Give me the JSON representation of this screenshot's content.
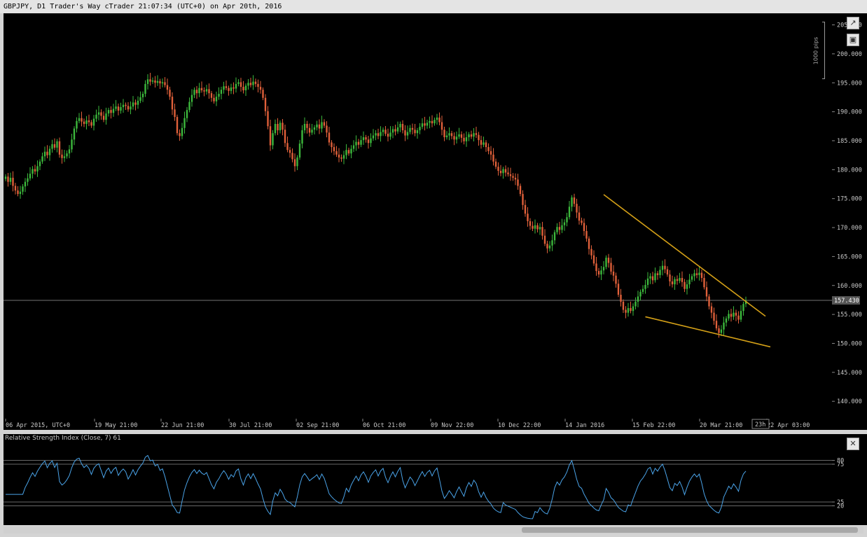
{
  "header": {
    "title": "GBPJPY, D1 Trader's Way cTrader 21:07:34 (UTC+0) on Apr 20th, 2016"
  },
  "toolbar": {
    "popout_icon": "popout-icon",
    "camera_icon": "camera-icon",
    "close_icon": "close-icon"
  },
  "pips_label": "1000 pips",
  "price_tag": "157.430",
  "time_tag": "23h",
  "rsi": {
    "label": "Relative Strength Index (Close, 7) 61",
    "value": 61,
    "level_labels": [
      "80",
      "75",
      "25",
      "20"
    ]
  },
  "colors": {
    "bull": "#3cb83c",
    "bear": "#e0603a",
    "trendline": "#d4a017",
    "rsi_line": "#4aa3e8",
    "background": "#000000"
  },
  "chart_data": [
    {
      "type": "candlestick",
      "symbol": "GBPJPY",
      "timeframe": "D1",
      "y_ticks": [
        "205.000",
        "200.000",
        "195.000",
        "190.000",
        "185.000",
        "180.000",
        "175.000",
        "170.000",
        "165.000",
        "160.000",
        "155.000",
        "150.000",
        "145.000",
        "140.000"
      ],
      "ylim": [
        137,
        207
      ],
      "x_ticks": [
        "06 Apr 2015, UTC+0",
        "19 May 21:00",
        "22 Jun 21:00",
        "30 Jul 21:00",
        "02 Sep 21:00",
        "06 Oct 21:00",
        "09 Nov 22:00",
        "10 Dec 22:00",
        "14 Jan 2016",
        "15 Feb 22:00",
        "20 Mar 21:00",
        "22 Apr 03:00"
      ],
      "current_price": 157.43,
      "closes": [
        178.8,
        177.9,
        178.6,
        177.2,
        176.4,
        175.8,
        176.2,
        177.1,
        177.9,
        178.5,
        179.3,
        180.1,
        179.7,
        180.6,
        181.4,
        182.3,
        183.1,
        182.5,
        183.6,
        184.4,
        183.8,
        184.9,
        182.6,
        182.0,
        182.3,
        182.8,
        183.5,
        185.2,
        187.1,
        188.4,
        188.9,
        188.3,
        187.9,
        188.5,
        188.2,
        187.6,
        188.8,
        189.5,
        189.9,
        189.3,
        188.6,
        189.7,
        190.3,
        189.8,
        190.5,
        190.9,
        190.2,
        190.8,
        191.2,
        191.0,
        190.4,
        190.9,
        191.6,
        191.2,
        191.9,
        192.5,
        193.1,
        194.8,
        195.6,
        195.2,
        195.4,
        195.0,
        195.3,
        194.9,
        195.1,
        194.6,
        193.8,
        192.6,
        190.4,
        189.1,
        186.3,
        185.8,
        187.2,
        188.9,
        190.3,
        191.7,
        192.9,
        193.8,
        193.2,
        194.1,
        193.7,
        193.5,
        193.9,
        193.2,
        192.4,
        191.8,
        192.6,
        193.1,
        193.8,
        194.4,
        194.1,
        193.6,
        194.2,
        194.0,
        194.8,
        195.1,
        194.3,
        193.7,
        194.5,
        195.0,
        194.6,
        195.2,
        194.8,
        194.3,
        193.8,
        192.4,
        190.1,
        187.5,
        184.2,
        186.3,
        187.9,
        186.8,
        188.1,
        186.9,
        184.6,
        183.4,
        182.9,
        181.8,
        180.6,
        182.1,
        184.5,
        186.8,
        187.9,
        187.2,
        186.4,
        186.9,
        187.3,
        187.8,
        187.1,
        188.2,
        187.6,
        186.4,
        184.7,
        183.9,
        183.2,
        182.6,
        182.1,
        181.9,
        182.5,
        183.4,
        182.8,
        183.6,
        184.2,
        184.8,
        184.3,
        185.1,
        185.6,
        185.2,
        184.6,
        185.4,
        185.9,
        186.3,
        185.8,
        186.5,
        186.9,
        186.2,
        185.7,
        186.4,
        187.0,
        186.6,
        187.3,
        187.9,
        186.8,
        185.9,
        186.5,
        187.2,
        186.9,
        186.3,
        186.8,
        187.4,
        188.0,
        187.6,
        188.1,
        188.4,
        188.0,
        188.6,
        189.0,
        188.2,
        186.9,
        185.6,
        185.9,
        186.3,
        185.8,
        185.2,
        185.7,
        186.1,
        185.5,
        184.9,
        185.6,
        186.1,
        185.7,
        186.3,
        186.0,
        185.1,
        184.3,
        184.7,
        183.9,
        183.2,
        182.6,
        181.4,
        180.5,
        179.8,
        179.4,
        180.1,
        179.5,
        179.2,
        178.9,
        178.6,
        178.3,
        177.2,
        175.8,
        173.9,
        172.4,
        171.1,
        170.3,
        169.8,
        170.4,
        169.7,
        170.1,
        168.6,
        167.2,
        166.4,
        166.9,
        167.8,
        169.2,
        170.1,
        169.6,
        170.4,
        170.9,
        171.8,
        173.6,
        175.2,
        174.1,
        172.6,
        171.2,
        170.8,
        169.4,
        168.1,
        166.3,
        165.2,
        163.8,
        162.5,
        161.9,
        162.6,
        163.2,
        164.8,
        163.9,
        162.4,
        161.7,
        160.3,
        158.4,
        157.2,
        155.8,
        155.3,
        156.1,
        155.6,
        156.4,
        157.2,
        158.1,
        158.9,
        159.4,
        160.1,
        161.2,
        161.6,
        160.9,
        162.1,
        161.8,
        162.7,
        163.4,
        162.8,
        161.9,
        160.7,
        160.2,
        161.1,
        160.8,
        161.3,
        160.6,
        159.4,
        160.2,
        161.0,
        161.6,
        162.1,
        161.8,
        162.2,
        161.3,
        159.7,
        158.1,
        156.4,
        155.3,
        153.9,
        152.6,
        151.8,
        152.4,
        153.6,
        154.3,
        155.1,
        154.6,
        155.3,
        154.8,
        154.1,
        155.6,
        156.8,
        157.43
      ]
    },
    {
      "type": "line",
      "title": "Relative Strength Index (Close, 7) 61",
      "levels": [
        80,
        75,
        25,
        20
      ],
      "ylim": [
        0,
        100
      ],
      "last_value": 61
    }
  ],
  "trendlines": [
    {
      "start": {
        "index": 244,
        "price": 175.7
      },
      "end": {
        "index": 310,
        "price": 154.7
      }
    },
    {
      "start": {
        "index": 261,
        "price": 154.6
      },
      "end": {
        "index": 312,
        "price": 149.4
      }
    }
  ]
}
